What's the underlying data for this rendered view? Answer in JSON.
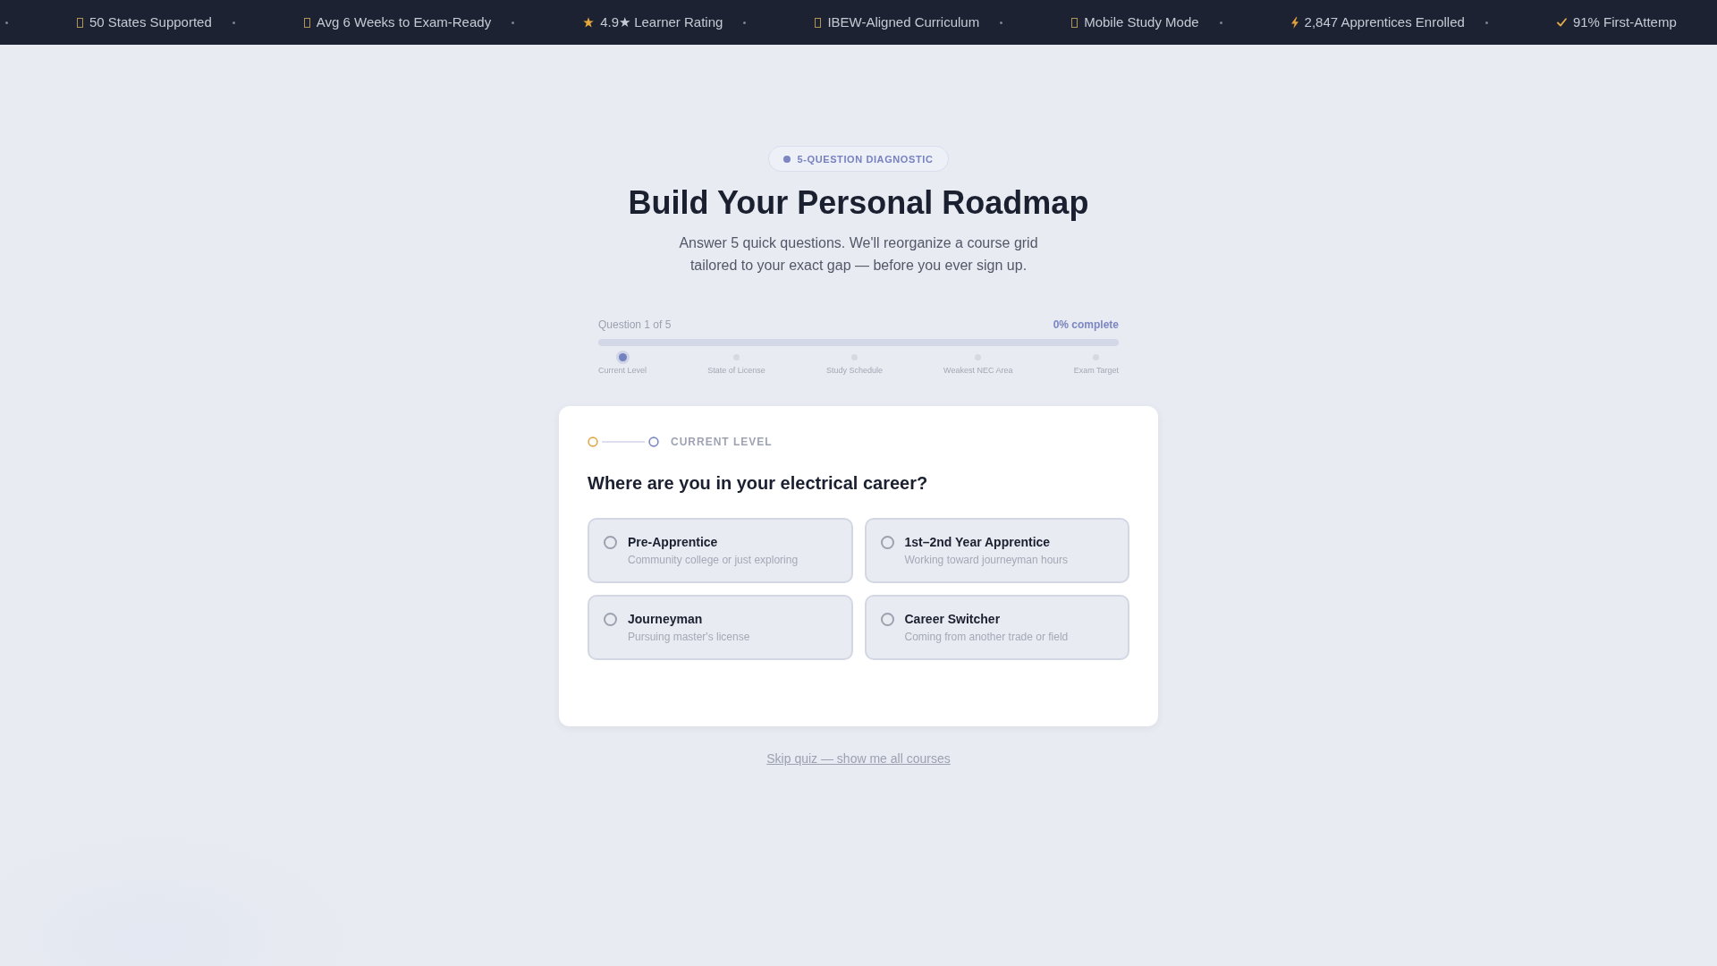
{
  "ticker": [
    {
      "kind": "square",
      "label": "50 States Supported"
    },
    {
      "kind": "square",
      "label": "Avg 6 Weeks to Exam-Ready"
    },
    {
      "kind": "star",
      "label": "4.9★ Learner Rating"
    },
    {
      "kind": "square",
      "label": "IBEW-Aligned Curriculum"
    },
    {
      "kind": "square",
      "label": "Mobile Study Mode"
    },
    {
      "kind": "bolt",
      "label": "2,847 Apprentices Enrolled"
    },
    {
      "kind": "check",
      "label": "91% First-Attemp"
    }
  ],
  "hero": {
    "badge": "5-QUESTION DIAGNOSTIC",
    "title": "Build Your Personal Roadmap",
    "subtitle": "Answer 5 quick questions. We'll reorganize a course grid tailored to your exact gap — before you ever sign up."
  },
  "progress": {
    "counter": "Question 1 of 5",
    "percent": "0% complete",
    "level": 0,
    "steps": [
      {
        "label": "Current Level",
        "active": true
      },
      {
        "label": "State of License",
        "active": false
      },
      {
        "label": "Study Schedule",
        "active": false
      },
      {
        "label": "Weakest NEC Area",
        "active": false
      },
      {
        "label": "Exam Target",
        "active": false
      }
    ]
  },
  "card": {
    "eyebrow": "CURRENT LEVEL",
    "question": "Where are you in your electrical career?",
    "options": [
      {
        "title": "Pre-Apprentice",
        "description": "Community college or just exploring",
        "selected": false
      },
      {
        "title": "1st–2nd Year Apprentice",
        "description": "Working toward journeyman hours",
        "selected": false
      },
      {
        "title": "Journeyman",
        "description": "Pursuing master's license",
        "selected": false
      },
      {
        "title": "Career Switcher",
        "description": "Coming from another trade or field",
        "selected": false
      }
    ]
  },
  "skip_link": "Skip quiz — show me all courses"
}
